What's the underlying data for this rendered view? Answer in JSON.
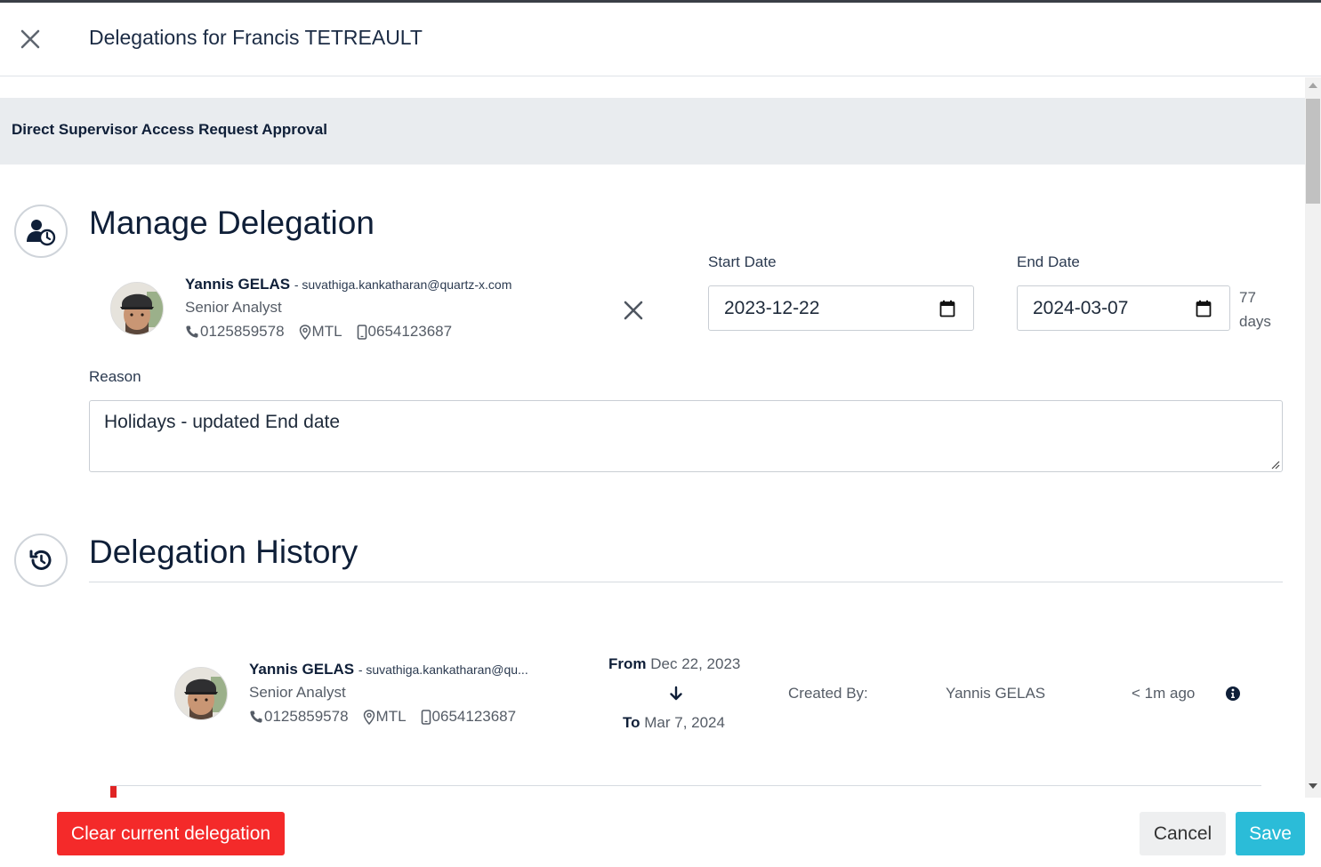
{
  "header": {
    "title": "Delegations for Francis TETREAULT"
  },
  "section_band": {
    "label": "Direct Supervisor Access Request Approval"
  },
  "manage": {
    "heading": "Manage Delegation",
    "delegate": {
      "name": "Yannis GELAS",
      "email": "- suvathiga.kankatharan@quartz-x.com",
      "role": "Senior Analyst",
      "phone": "0125859578",
      "location": "MTL",
      "mobile": "0654123687"
    },
    "start_date": {
      "label": "Start Date",
      "value": "2023-12-22"
    },
    "end_date": {
      "label": "End Date",
      "value": "2024-03-07"
    },
    "duration": {
      "value": "77",
      "unit": "days"
    },
    "reason": {
      "label": "Reason",
      "value": "Holidays - updated End date"
    }
  },
  "history": {
    "heading": "Delegation History",
    "entries": [
      {
        "name": "Yannis GELAS",
        "email": "- suvathiga.kankatharan@qu...",
        "role": "Senior Analyst",
        "phone": "0125859578",
        "location": "MTL",
        "mobile": "0654123687",
        "from_label": "From",
        "from_date": "Dec 22, 2023",
        "to_label": "To",
        "to_date": "Mar 7, 2024",
        "created_by_label": "Created By:",
        "created_by": "Yannis GELAS",
        "time_ago": "< 1m ago"
      }
    ]
  },
  "footer": {
    "clear_label": "Clear current delegation",
    "cancel_label": "Cancel",
    "save_label": "Save"
  },
  "colors": {
    "danger": "#f42a2a",
    "primary": "#2bbcd8",
    "band": "#e9ecef",
    "heading": "#0f1f38"
  }
}
